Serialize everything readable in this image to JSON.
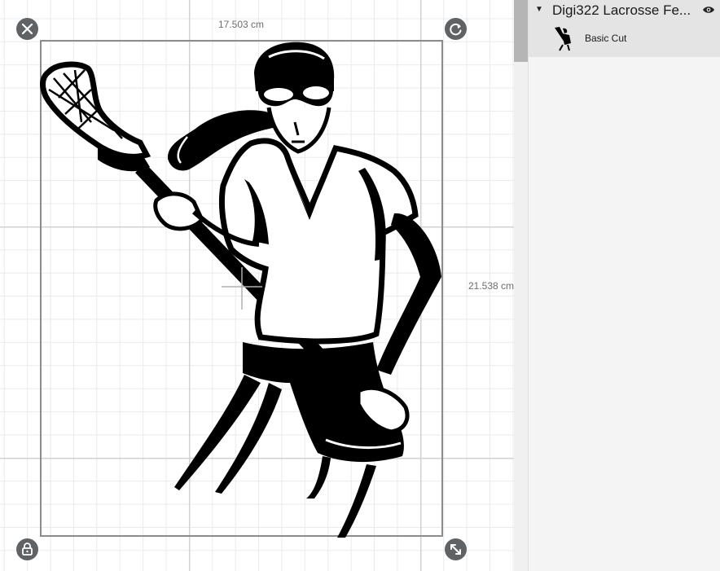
{
  "canvas": {
    "width_label": "17.503 cm",
    "height_label": "21.538 cm"
  },
  "icons": {
    "delete": "close-icon",
    "rotate": "rotate-icon",
    "lock": "lock-icon",
    "resize": "resize-diagonal-icon",
    "visibility": "eye-icon",
    "expand": "caret-down-icon"
  },
  "layers": {
    "group_name": "Digi322 Lacrosse Fe...",
    "items": [
      {
        "label": "Basic Cut"
      }
    ]
  },
  "colors": {
    "handle": "#5f6366",
    "selection_border": "#8c8c8c",
    "layer_group_bg": "#e4e4e4",
    "panel_bg": "#f4f4f4"
  }
}
